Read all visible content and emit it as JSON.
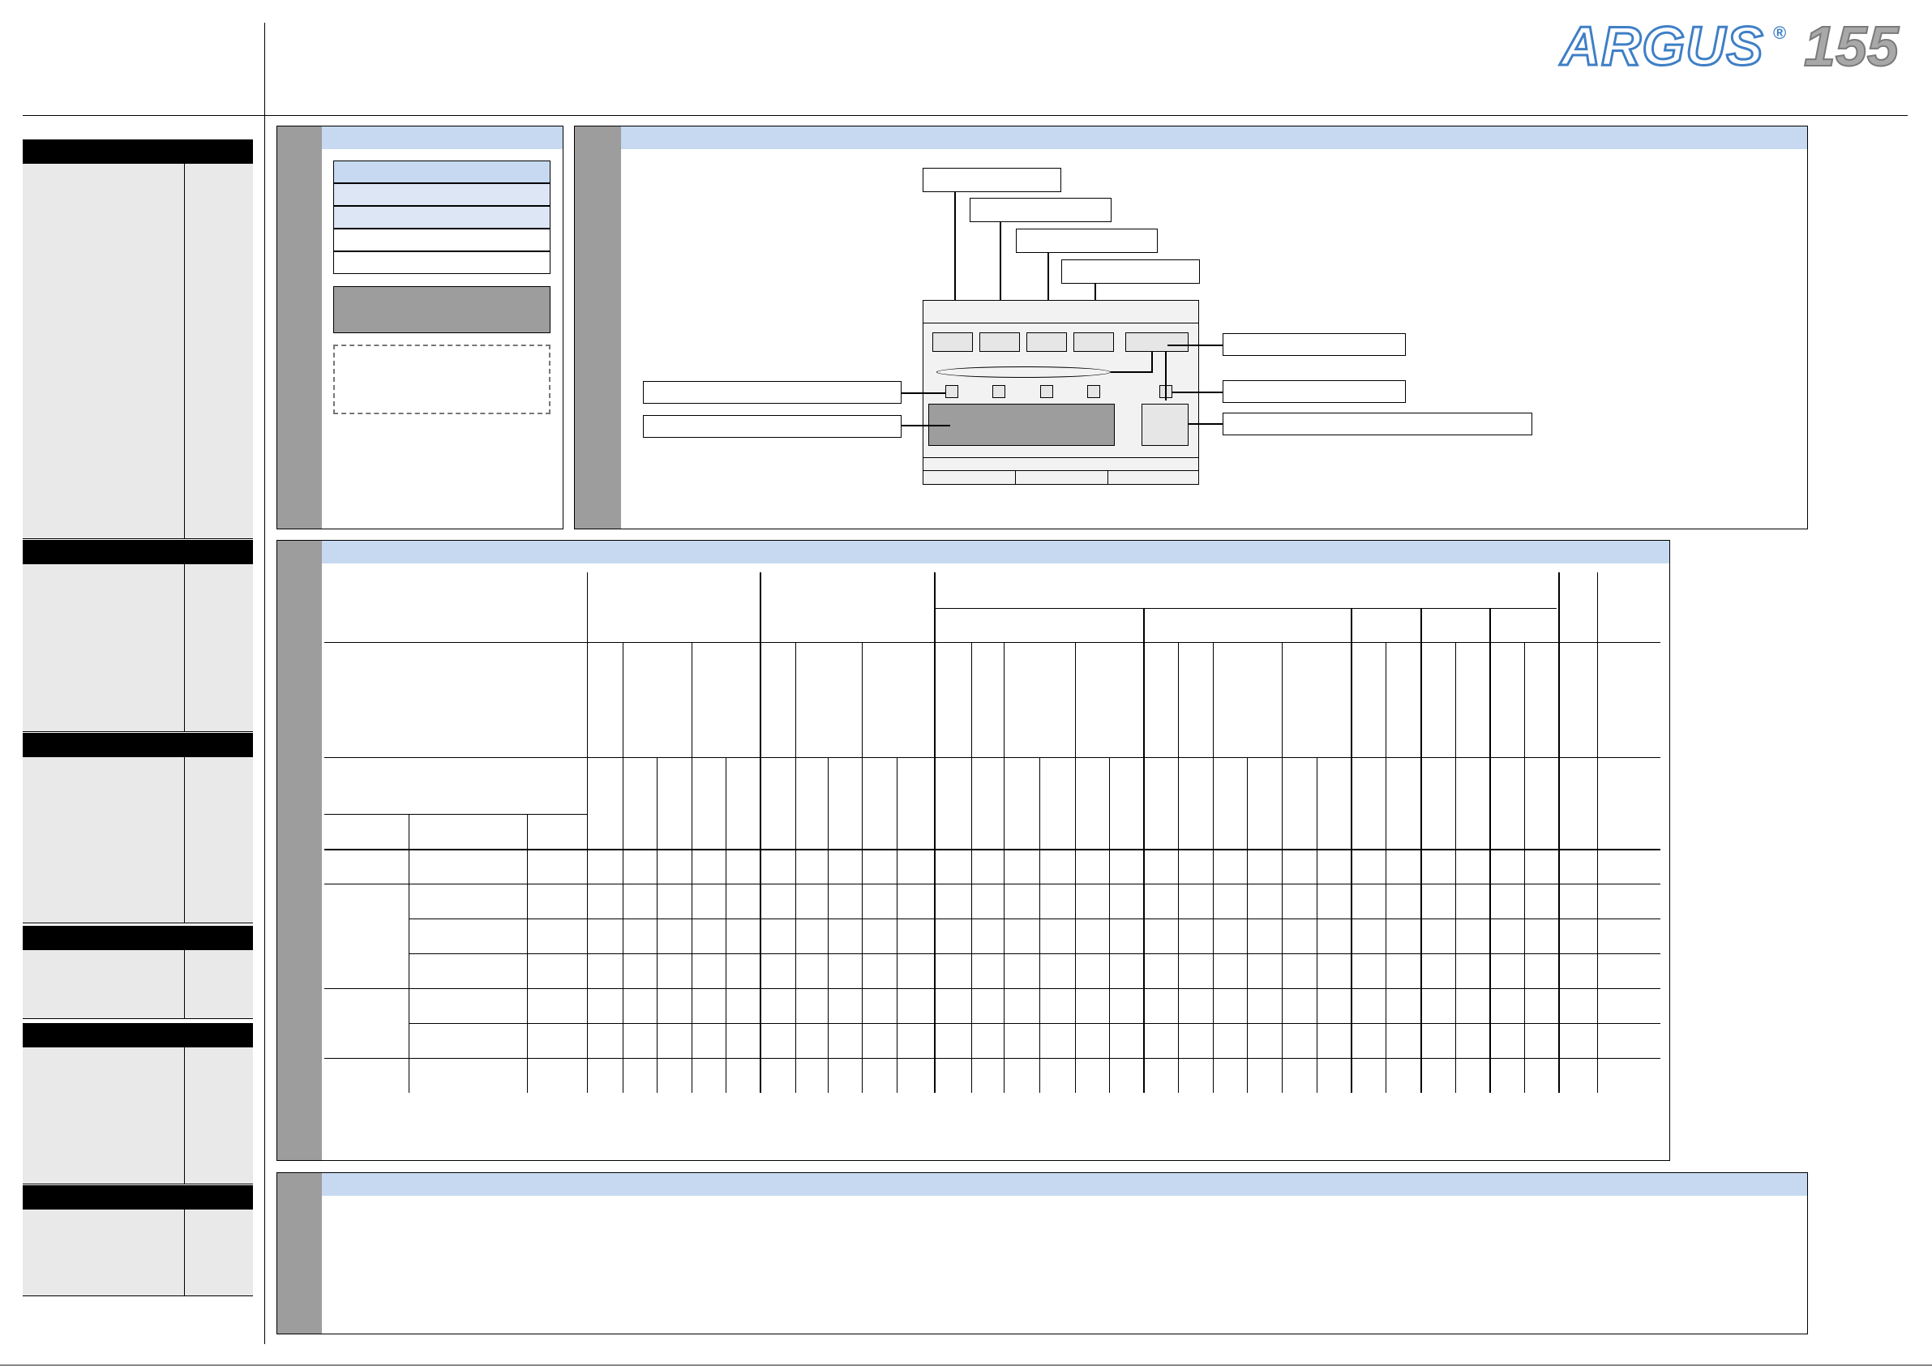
{
  "brand": {
    "logo_text": "ARGUS",
    "logo_mark": "®",
    "model": "155",
    "accent_color": "#3f7fc6",
    "model_color": "#a8a8a8"
  },
  "colors": {
    "panel_header": "#c6d9f0",
    "side_strip": "#9d9d9d",
    "index_header": "#000000",
    "index_row": "#e9e9e9"
  }
}
